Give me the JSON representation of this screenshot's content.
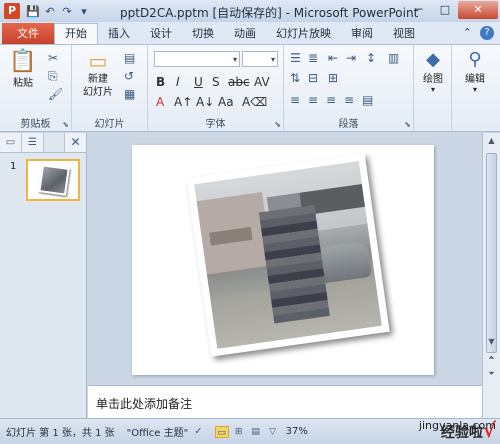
{
  "titlebar": {
    "title": "pptD2CA.pptm [自动保存的] - Microsoft PowerPoint",
    "app_icon": "P",
    "qat": [
      "save-icon",
      "undo-icon",
      "redo-icon",
      "customize-icon"
    ],
    "window_buttons": [
      "─",
      "□",
      "✕"
    ]
  },
  "tabs": {
    "file": "文件",
    "items": [
      "开始",
      "插入",
      "设计",
      "切换",
      "动画",
      "幻灯片放映",
      "审阅",
      "视图"
    ],
    "active": "开始"
  },
  "ribbon": {
    "clipboard": {
      "label": "剪贴板",
      "paste": "粘贴"
    },
    "slides": {
      "label": "幻灯片",
      "new_slide": "新建\n幻灯片"
    },
    "font": {
      "label": "字体"
    },
    "paragraph": {
      "label": "段落"
    },
    "drawing": {
      "draw": "绘图"
    },
    "editing": {
      "edit": "编辑"
    }
  },
  "left_pane": {
    "slide_number": "1"
  },
  "notes": {
    "placeholder": "单击此处添加备注"
  },
  "statusbar": {
    "slide_info": "幻灯片 第 1 张，共 1 张",
    "theme": "\"Office 主题\"",
    "zoom": "37%"
  },
  "watermark": {
    "text": "经验啦",
    "url": "jingyanla.com",
    "check": "√"
  }
}
